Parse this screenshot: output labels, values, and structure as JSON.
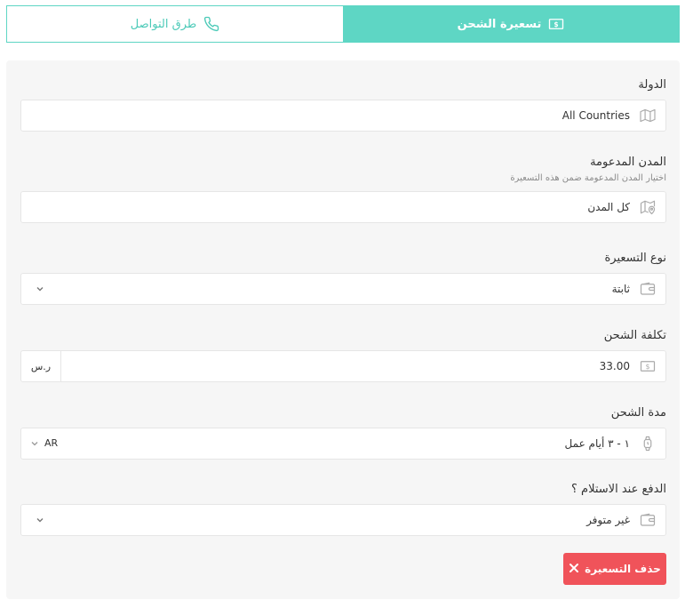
{
  "tabs": {
    "pricing_label": "تسعيرة الشحن",
    "contact_label": "طرق التواصل"
  },
  "colors": {
    "accent": "#5ed6c4",
    "danger": "#f0535a",
    "panel_bg": "#f6f6f6"
  },
  "country": {
    "label": "الدولة",
    "value": "All Countries",
    "icon": "map-icon"
  },
  "cities": {
    "label": "المدن المدعومة",
    "hint": "اختيار المدن المدعومة ضمن هذه التسعيرة",
    "value": "كل المدن",
    "icon": "map-pin-icon"
  },
  "pricing_type": {
    "label": "نوع التسعيرة",
    "value": "ثابتة",
    "icon": "wallet-icon"
  },
  "shipping_cost": {
    "label": "تكلفة الشحن",
    "value": "33.00",
    "currency": "ر.س",
    "icon": "money-icon"
  },
  "shipping_duration": {
    "label": "مدة الشحن",
    "value": "١ - ٣ أيام عمل",
    "language": "AR",
    "icon": "watch-icon"
  },
  "cod": {
    "label": "الدفع عند الاستلام ؟",
    "value": "غير متوفر",
    "icon": "wallet-icon"
  },
  "delete_button": {
    "label": "حذف التسعيرة"
  }
}
